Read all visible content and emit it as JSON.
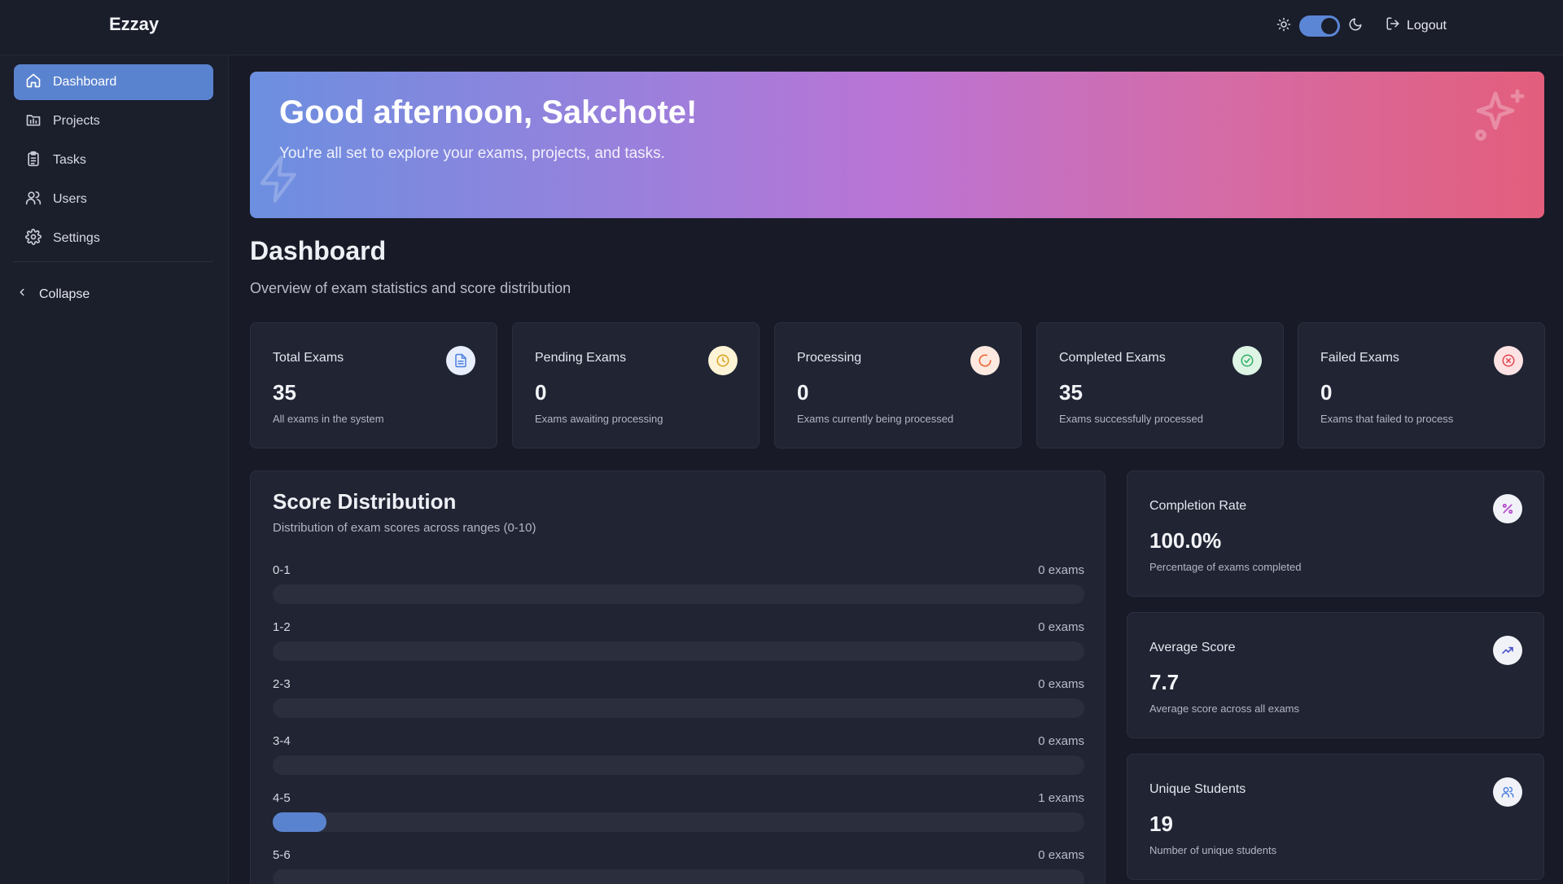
{
  "app": {
    "brand": "Ezzay"
  },
  "header": {
    "logout_label": "Logout",
    "theme_mode": "dark"
  },
  "sidebar": {
    "items": [
      {
        "label": "Dashboard",
        "icon": "home-icon",
        "active": true
      },
      {
        "label": "Projects",
        "icon": "projects-icon",
        "active": false
      },
      {
        "label": "Tasks",
        "icon": "clipboard-icon",
        "active": false
      },
      {
        "label": "Users",
        "icon": "users-icon",
        "active": false
      },
      {
        "label": "Settings",
        "icon": "gear-icon",
        "active": false
      }
    ],
    "collapse_label": "Collapse"
  },
  "banner": {
    "title": "Good afternoon, Sakchote!",
    "subtitle": "You're all set to explore your exams, projects, and tasks."
  },
  "page": {
    "title": "Dashboard",
    "subtitle": "Overview of exam statistics and score distribution"
  },
  "stats": [
    {
      "label": "Total Exams",
      "value": "35",
      "desc": "All exams in the system",
      "icon": "document-icon",
      "color": "#4a7fe0"
    },
    {
      "label": "Pending Exams",
      "value": "0",
      "desc": "Exams awaiting processing",
      "icon": "clock-icon",
      "color": "#d7a21e"
    },
    {
      "label": "Processing",
      "value": "0",
      "desc": "Exams currently being processed",
      "icon": "spinner-icon",
      "color": "#ea6a3a"
    },
    {
      "label": "Completed Exams",
      "value": "35",
      "desc": "Exams successfully processed",
      "icon": "check-circle-icon",
      "color": "#2fae62"
    },
    {
      "label": "Failed Exams",
      "value": "0",
      "desc": "Exams that failed to process",
      "icon": "x-circle-icon",
      "color": "#e0444e"
    }
  ],
  "distribution": {
    "title": "Score Distribution",
    "subtitle": "Distribution of exam scores across ranges (0-10)",
    "rows": [
      {
        "range": "0-1",
        "count_label": "0 exams",
        "count": 0
      },
      {
        "range": "1-2",
        "count_label": "0 exams",
        "count": 0
      },
      {
        "range": "2-3",
        "count_label": "0 exams",
        "count": 0
      },
      {
        "range": "3-4",
        "count_label": "0 exams",
        "count": 0
      },
      {
        "range": "4-5",
        "count_label": "1 exams",
        "count": 1
      },
      {
        "range": "5-6",
        "count_label": "0 exams",
        "count": 0
      }
    ]
  },
  "metrics": [
    {
      "label": "Completion Rate",
      "value": "100.0%",
      "desc": "Percentage of exams completed",
      "icon": "percent-icon",
      "color": "#b040c8"
    },
    {
      "label": "Average Score",
      "value": "7.7",
      "desc": "Average score across all exams",
      "icon": "trending-up-icon",
      "color": "#4a52c8"
    },
    {
      "label": "Unique Students",
      "value": "19",
      "desc": "Number of unique students",
      "icon": "users-icon",
      "color": "#4a7fe0"
    }
  ]
}
